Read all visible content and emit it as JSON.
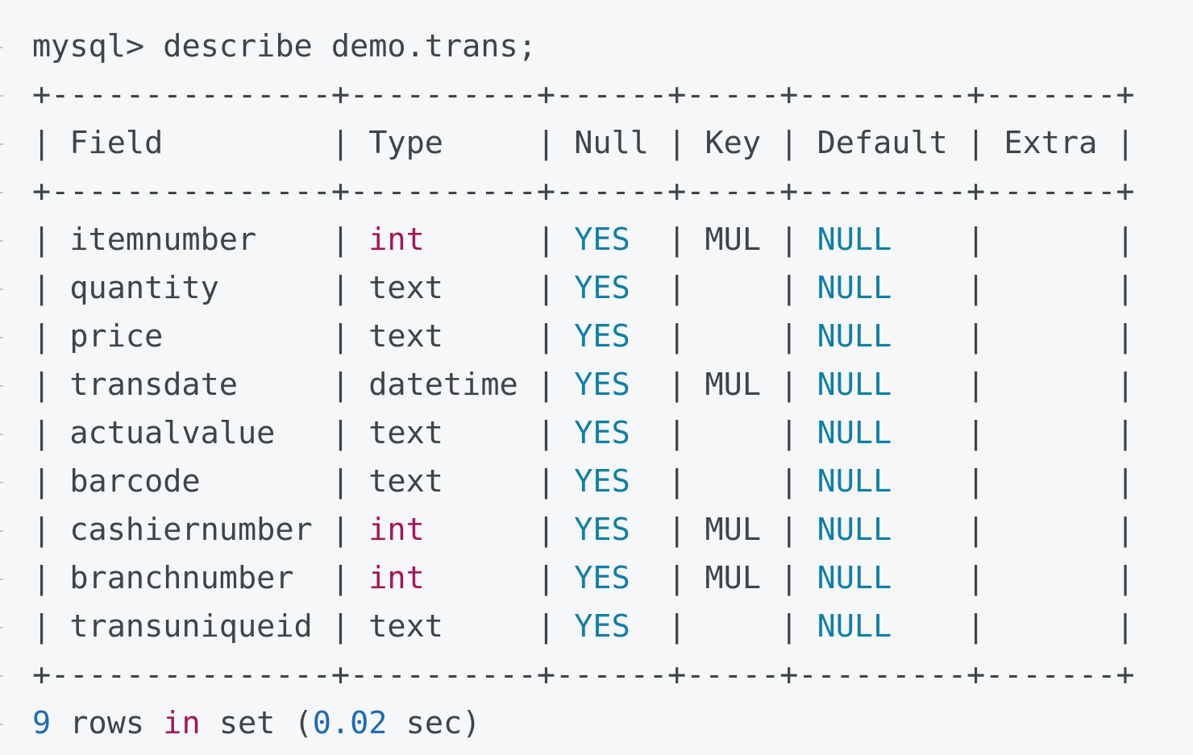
{
  "command": {
    "prompt": "mysql>",
    "text": "describe demo.trans;"
  },
  "table": {
    "border_line": "+---------------+----------+------+-----+---------+-------+",
    "headers": [
      "Field",
      "Type",
      "Null",
      "Key",
      "Default",
      "Extra"
    ],
    "rows": [
      {
        "field": "itemnumber",
        "type": "int",
        "null": "YES",
        "key": "MUL",
        "default": "NULL",
        "extra": ""
      },
      {
        "field": "quantity",
        "type": "text",
        "null": "YES",
        "key": "",
        "default": "NULL",
        "extra": ""
      },
      {
        "field": "price",
        "type": "text",
        "null": "YES",
        "key": "",
        "default": "NULL",
        "extra": ""
      },
      {
        "field": "transdate",
        "type": "datetime",
        "null": "YES",
        "key": "MUL",
        "default": "NULL",
        "extra": ""
      },
      {
        "field": "actualvalue",
        "type": "text",
        "null": "YES",
        "key": "",
        "default": "NULL",
        "extra": ""
      },
      {
        "field": "barcode",
        "type": "text",
        "null": "YES",
        "key": "",
        "default": "NULL",
        "extra": ""
      },
      {
        "field": "cashiernumber",
        "type": "int",
        "null": "YES",
        "key": "MUL",
        "default": "NULL",
        "extra": ""
      },
      {
        "field": "branchnumber",
        "type": "int",
        "null": "YES",
        "key": "MUL",
        "default": "NULL",
        "extra": ""
      },
      {
        "field": "transuniqueid",
        "type": "text",
        "null": "YES",
        "key": "",
        "default": "NULL",
        "extra": ""
      }
    ]
  },
  "footer": {
    "count": "9",
    "rows_word": "rows",
    "in_word": "in",
    "set_word": "set",
    "open_paren": "(",
    "time": "0.02",
    "unit": "sec)"
  },
  "colors": {
    "background": "#f6f7f8",
    "text": "#3f4448",
    "type_keyword": "#a3185a",
    "value_keyword": "#0f7fa6",
    "number": "#1c6bb5"
  }
}
